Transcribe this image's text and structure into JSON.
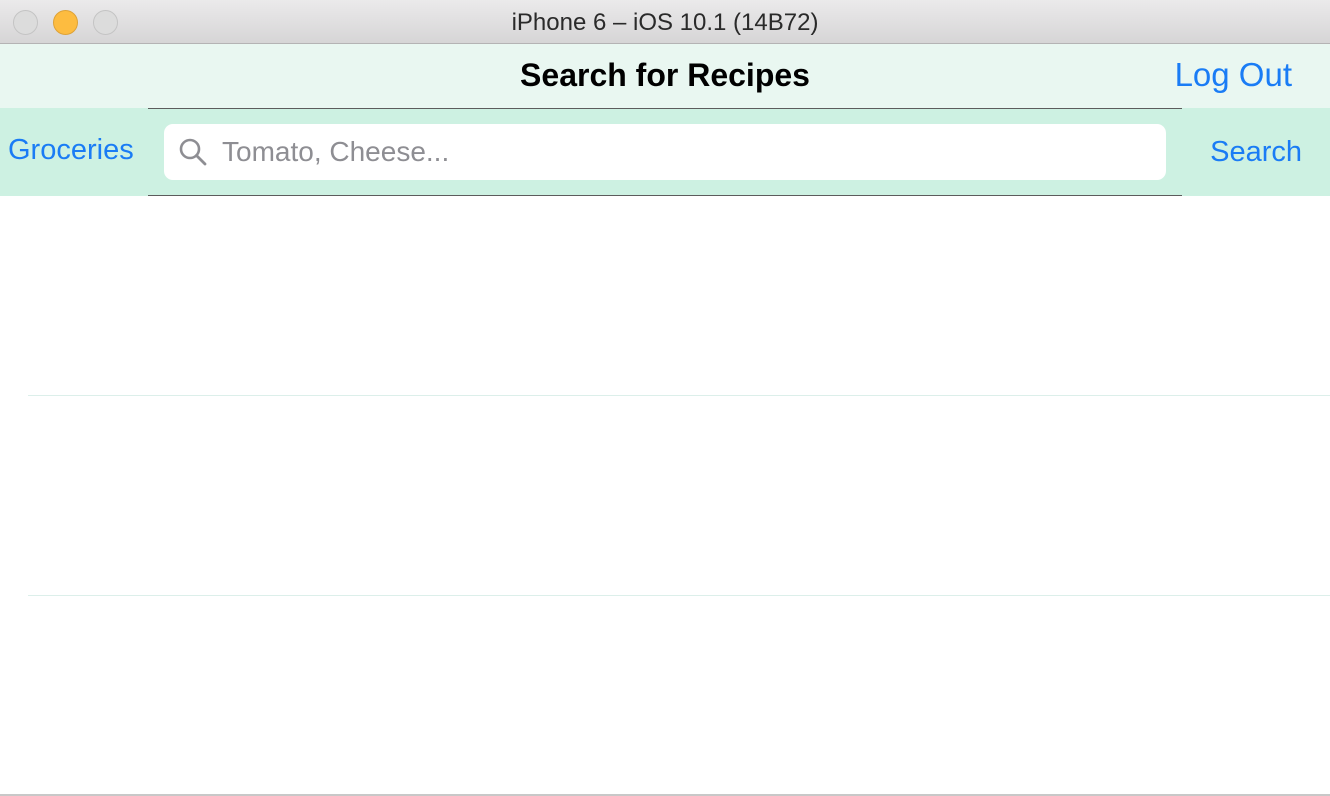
{
  "window": {
    "title": "iPhone 6 – iOS 10.1 (14B72)"
  },
  "navbar": {
    "title": "Search for Recipes",
    "logout_label": "Log Out"
  },
  "search": {
    "groceries_label": "Groceries",
    "placeholder": "Tomato, Cheese...",
    "value": "",
    "search_label": "Search",
    "icon": "search-icon"
  },
  "table": {
    "rows": [
      "",
      "",
      ""
    ]
  },
  "colors": {
    "accent": "#1a7cf5",
    "navbar_bg": "#e9f7f1",
    "searchbar_bg": "#cdf1e2"
  }
}
